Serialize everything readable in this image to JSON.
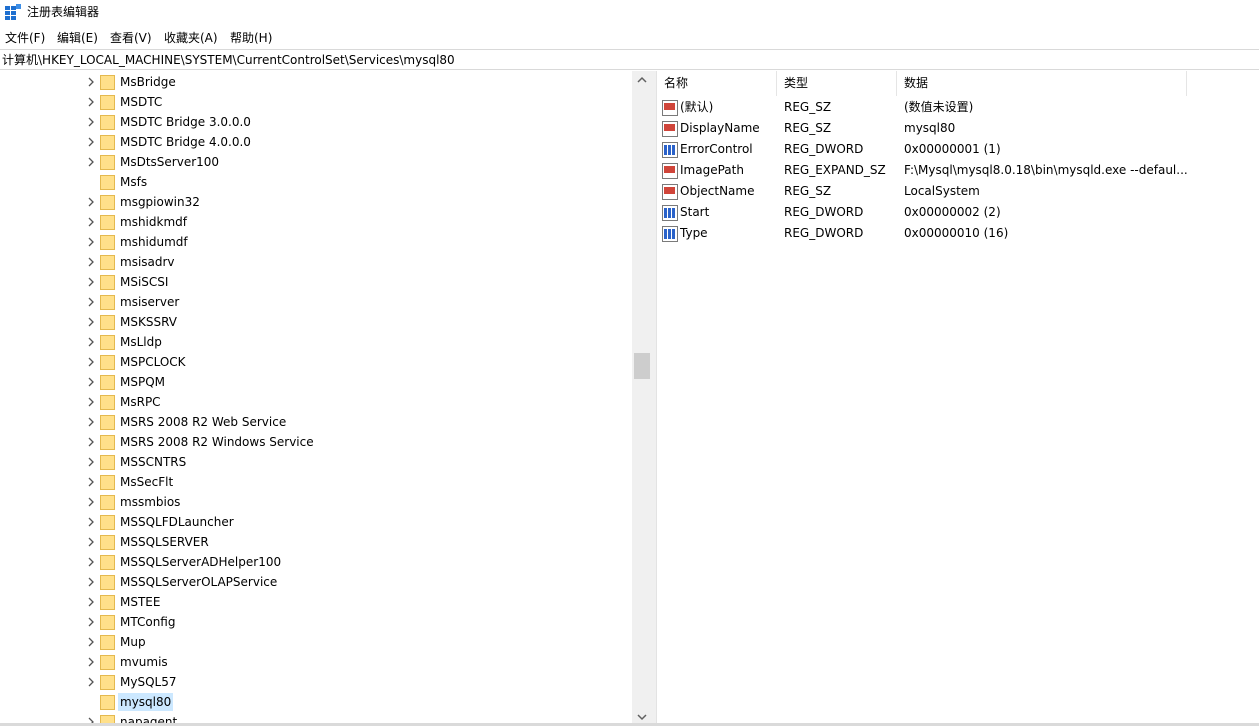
{
  "window": {
    "title": "注册表编辑器"
  },
  "menu": [
    "文件(F)",
    "编辑(E)",
    "查看(V)",
    "收藏夹(A)",
    "帮助(H)"
  ],
  "address": "计算机\\HKEY_LOCAL_MACHINE\\SYSTEM\\CurrentControlSet\\Services\\mysql80",
  "tree": [
    {
      "label": "MsBridge",
      "expandable": true
    },
    {
      "label": "MSDTC",
      "expandable": true
    },
    {
      "label": "MSDTC Bridge 3.0.0.0",
      "expandable": true
    },
    {
      "label": "MSDTC Bridge 4.0.0.0",
      "expandable": true
    },
    {
      "label": "MsDtsServer100",
      "expandable": true
    },
    {
      "label": "Msfs",
      "expandable": false
    },
    {
      "label": "msgpiowin32",
      "expandable": true
    },
    {
      "label": "mshidkmdf",
      "expandable": true
    },
    {
      "label": "mshidumdf",
      "expandable": true
    },
    {
      "label": "msisadrv",
      "expandable": true
    },
    {
      "label": "MSiSCSI",
      "expandable": true
    },
    {
      "label": "msiserver",
      "expandable": true
    },
    {
      "label": "MSKSSRV",
      "expandable": true
    },
    {
      "label": "MsLldp",
      "expandable": true
    },
    {
      "label": "MSPCLOCK",
      "expandable": true
    },
    {
      "label": "MSPQM",
      "expandable": true
    },
    {
      "label": "MsRPC",
      "expandable": true
    },
    {
      "label": "MSRS 2008 R2 Web Service",
      "expandable": true
    },
    {
      "label": "MSRS 2008 R2 Windows Service",
      "expandable": true
    },
    {
      "label": "MSSCNTRS",
      "expandable": true
    },
    {
      "label": "MsSecFlt",
      "expandable": true
    },
    {
      "label": "mssmbios",
      "expandable": true
    },
    {
      "label": "MSSQLFDLauncher",
      "expandable": true
    },
    {
      "label": "MSSQLSERVER",
      "expandable": true
    },
    {
      "label": "MSSQLServerADHelper100",
      "expandable": true
    },
    {
      "label": "MSSQLServerOLAPService",
      "expandable": true
    },
    {
      "label": "MSTEE",
      "expandable": true
    },
    {
      "label": "MTConfig",
      "expandable": true
    },
    {
      "label": "Mup",
      "expandable": true
    },
    {
      "label": "mvumis",
      "expandable": true
    },
    {
      "label": "MySQL57",
      "expandable": true
    },
    {
      "label": "mysql80",
      "expandable": false,
      "selected": true
    },
    {
      "label": "napagent",
      "expandable": true
    }
  ],
  "columns": [
    "名称",
    "类型",
    "数据"
  ],
  "values": [
    {
      "icon": "string-value-icon",
      "name": "(默认)",
      "type": "REG_SZ",
      "data": "(数值未设置)"
    },
    {
      "icon": "string-value-icon",
      "name": "DisplayName",
      "type": "REG_SZ",
      "data": "mysql80"
    },
    {
      "icon": "dword-value-icon",
      "name": "ErrorControl",
      "type": "REG_DWORD",
      "data": "0x00000001 (1)"
    },
    {
      "icon": "string-value-icon",
      "name": "ImagePath",
      "type": "REG_EXPAND_SZ",
      "data": "F:\\Mysql\\mysql8.0.18\\bin\\mysqld.exe --defaul..."
    },
    {
      "icon": "string-value-icon",
      "name": "ObjectName",
      "type": "REG_SZ",
      "data": "LocalSystem"
    },
    {
      "icon": "dword-value-icon",
      "name": "Start",
      "type": "REG_DWORD",
      "data": "0x00000002 (2)"
    },
    {
      "icon": "dword-value-icon",
      "name": "Type",
      "type": "REG_DWORD",
      "data": "0x00000010 (16)"
    }
  ],
  "colors": {
    "selection": "#cce8ff",
    "folder": "#ffe08a"
  }
}
